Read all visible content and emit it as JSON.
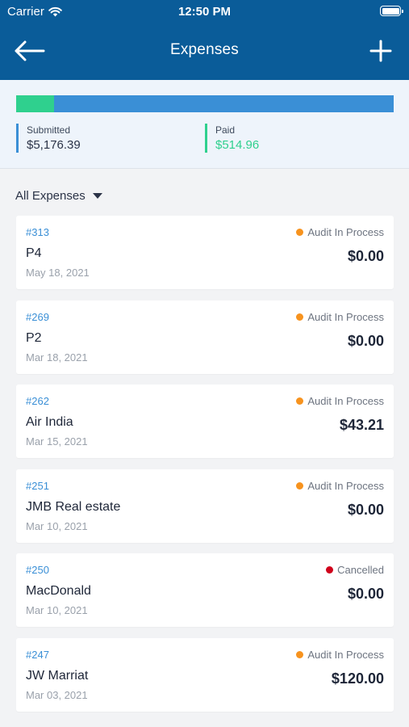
{
  "status_bar": {
    "carrier": "Carrier",
    "time": "12:50 PM"
  },
  "nav": {
    "title": "Expenses",
    "back_icon": "arrow-left-icon",
    "add_icon": "plus-icon"
  },
  "summary": {
    "submitted_label": "Submitted",
    "submitted_value": "$5,176.39",
    "paid_label": "Paid",
    "paid_value": "$514.96",
    "paid_fraction": 0.0995,
    "colors": {
      "submitted": "#3a8fd6",
      "paid": "#2fd08e"
    }
  },
  "filter": {
    "label": "All Expenses"
  },
  "status_colors": {
    "Audit In Process": "#f7931e",
    "Cancelled": "#d0021b"
  },
  "expenses": [
    {
      "number": "#313",
      "name": "P4",
      "date": "May 18, 2021",
      "status": "Audit In Process",
      "amount": "$0.00"
    },
    {
      "number": "#269",
      "name": "P2",
      "date": "Mar 18, 2021",
      "status": "Audit In Process",
      "amount": "$0.00"
    },
    {
      "number": "#262",
      "name": "Air India",
      "date": "Mar 15, 2021",
      "status": "Audit In Process",
      "amount": "$43.21"
    },
    {
      "number": "#251",
      "name": "JMB Real estate",
      "date": "Mar 10, 2021",
      "status": "Audit In Process",
      "amount": "$0.00"
    },
    {
      "number": "#250",
      "name": "MacDonald",
      "date": "Mar 10, 2021",
      "status": "Cancelled",
      "amount": "$0.00"
    },
    {
      "number": "#247",
      "name": "JW Marriat",
      "date": "Mar 03, 2021",
      "status": "Audit In Process",
      "amount": "$120.00"
    }
  ]
}
